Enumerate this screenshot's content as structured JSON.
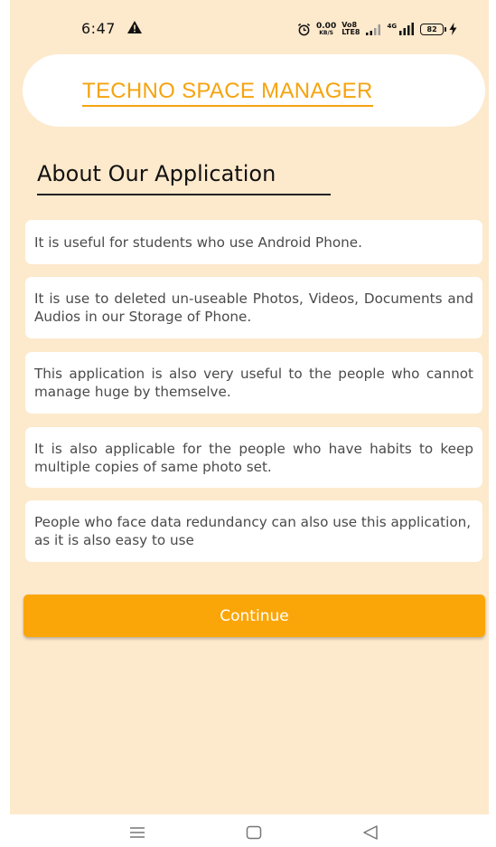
{
  "status_bar": {
    "time": "6:47",
    "net_speed_value": "0.00",
    "net_speed_unit": "KB/S",
    "volte_top": "Vo8",
    "volte_bottom": "LTE8",
    "network_label": "4G",
    "battery_level": "82"
  },
  "header": {
    "title": "TECHNO SPACE MANAGER"
  },
  "section": {
    "title": "About Our Application"
  },
  "cards": [
    "It is useful for students who use Android Phone.",
    "It is use to deleted un-useable Photos, Videos, Documents and Audios in our Storage of Phone.",
    "This application is also very useful to the people who cannot manage huge by themselve.",
    "It is also applicable for the people who have habits to keep multiple copies of same photo set.",
    "People who face data redundancy can also use this application, as it is also easy to use"
  ],
  "actions": {
    "continue_label": "Continue"
  },
  "colors": {
    "background": "#fde9cc",
    "accent": "#fba608",
    "title_orange": "#f5a30e",
    "card": "#ffffff"
  },
  "icons": {
    "status": [
      "warning-icon",
      "alarm-icon",
      "signal-icon",
      "battery-icon",
      "charging-bolt-icon"
    ],
    "nav": [
      "menu-icon",
      "home-icon",
      "back-icon"
    ]
  }
}
